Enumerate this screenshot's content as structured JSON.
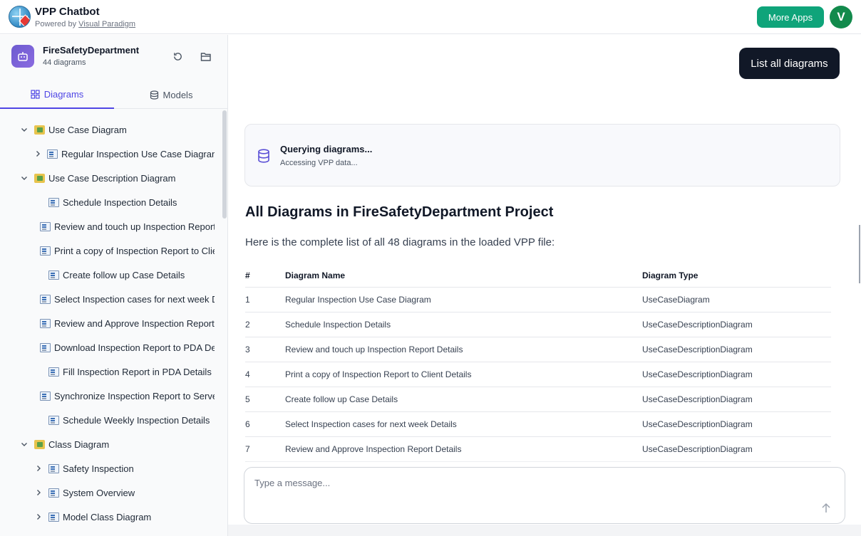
{
  "header": {
    "title": "VPP Chatbot",
    "powered_prefix": "Powered by",
    "powered_link": "Visual Paradigm",
    "more_apps": "More Apps",
    "avatar_letter": "V"
  },
  "project": {
    "name": "FireSafetyDepartment",
    "count": "44 diagrams"
  },
  "tabs": {
    "diagrams": "Diagrams",
    "models": "Models"
  },
  "tree": [
    {
      "label": "Use Case Diagram",
      "level": 0,
      "kind": "folder",
      "chevron": "down"
    },
    {
      "label": "Regular Inspection Use Case Diagram",
      "level": 1,
      "kind": "diagram",
      "chevron": "right"
    },
    {
      "label": "Use Case Description Diagram",
      "level": 0,
      "kind": "folder",
      "chevron": "down"
    },
    {
      "label": "Schedule Inspection Details",
      "level": 1,
      "kind": "diagram",
      "chevron": "none"
    },
    {
      "label": "Review and touch up Inspection Report Details",
      "level": 1,
      "kind": "diagram",
      "chevron": "none"
    },
    {
      "label": "Print a copy of Inspection Report to Client Details",
      "level": 1,
      "kind": "diagram",
      "chevron": "none"
    },
    {
      "label": "Create follow up Case Details",
      "level": 1,
      "kind": "diagram",
      "chevron": "none"
    },
    {
      "label": "Select Inspection cases for next week Details",
      "level": 1,
      "kind": "diagram",
      "chevron": "none"
    },
    {
      "label": "Review and Approve Inspection Report Details",
      "level": 1,
      "kind": "diagram",
      "chevron": "none"
    },
    {
      "label": "Download Inspection Report to PDA Details",
      "level": 1,
      "kind": "diagram",
      "chevron": "none"
    },
    {
      "label": "Fill Inspection Report in PDA Details",
      "level": 1,
      "kind": "diagram",
      "chevron": "none"
    },
    {
      "label": "Synchronize Inspection Report to Server Details",
      "level": 1,
      "kind": "diagram",
      "chevron": "none"
    },
    {
      "label": "Schedule Weekly Inspection Details",
      "level": 1,
      "kind": "diagram",
      "chevron": "none"
    },
    {
      "label": "Class Diagram",
      "level": 0,
      "kind": "folder",
      "chevron": "down"
    },
    {
      "label": "Safety Inspection",
      "level": 1,
      "kind": "diagram",
      "chevron": "right"
    },
    {
      "label": "System Overview",
      "level": 1,
      "kind": "diagram",
      "chevron": "right"
    },
    {
      "label": "Model Class Diagram",
      "level": 1,
      "kind": "diagram",
      "chevron": "right"
    }
  ],
  "chat": {
    "user_message": "List all diagrams",
    "query_title": "Querying diagrams...",
    "query_sub": "Accessing VPP data...",
    "heading": "All Diagrams in FireSafetyDepartment Project",
    "intro": "Here is the complete list of all 48 diagrams in the loaded VPP file:",
    "table_headers": [
      "#",
      "Diagram Name",
      "Diagram Type"
    ],
    "rows": [
      [
        "1",
        "Regular Inspection Use Case Diagram",
        "UseCaseDiagram"
      ],
      [
        "2",
        "Schedule Inspection Details",
        "UseCaseDescriptionDiagram"
      ],
      [
        "3",
        "Review and touch up Inspection Report Details",
        "UseCaseDescriptionDiagram"
      ],
      [
        "4",
        "Print a copy of Inspection Report to Client Details",
        "UseCaseDescriptionDiagram"
      ],
      [
        "5",
        "Create follow up Case Details",
        "UseCaseDescriptionDiagram"
      ],
      [
        "6",
        "Select Inspection cases for next week Details",
        "UseCaseDescriptionDiagram"
      ],
      [
        "7",
        "Review and Approve Inspection Report Details",
        "UseCaseDescriptionDiagram"
      ]
    ],
    "input_placeholder": "Type a message..."
  },
  "icons": {
    "refresh": "refresh-icon",
    "folder": "folder-open-icon",
    "database": "database-icon",
    "send": "arrow-up-icon"
  }
}
